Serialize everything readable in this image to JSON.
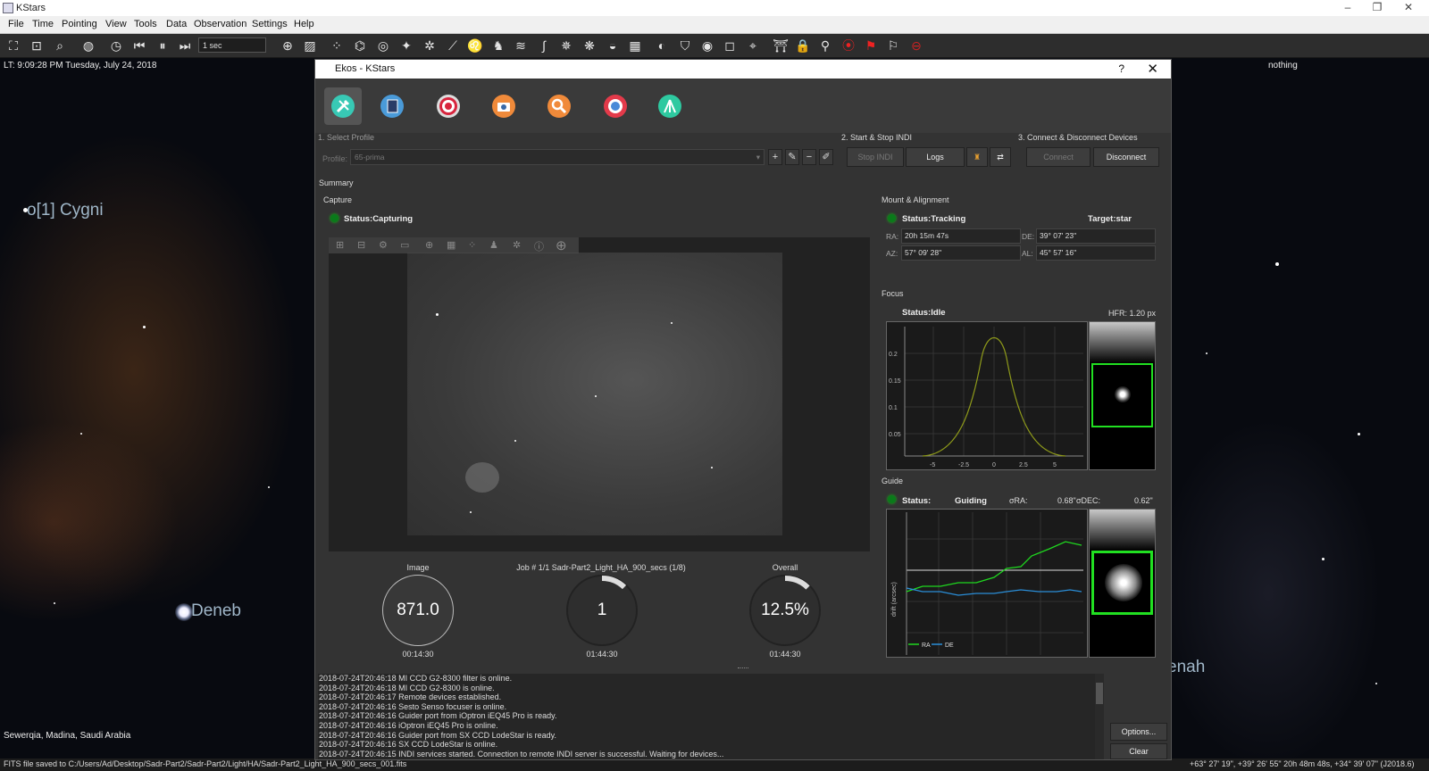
{
  "window": {
    "title": "KStars",
    "controls": [
      "–",
      "❐",
      "✕"
    ]
  },
  "menu": [
    "File",
    "Time",
    "Pointing",
    "View",
    "Tools",
    "Data",
    "Observation",
    "Settings",
    "Help"
  ],
  "toolbar": {
    "time_step": "1 sec"
  },
  "sky": {
    "clock": "LT: 9:09:28 PM   Tuesday, July 24, 2018",
    "focus_object": "nothing",
    "labels": {
      "cygni": "o[1] Cygni",
      "deneb": "Deneb",
      "gienah": "Gienah"
    },
    "location": "Sewerqia, Madina, Saudi Arabia",
    "status_left": "FITS file saved to C:/Users/Ad/Desktop/Sadr-Part2/Sadr-Part2/Light/HA/Sadr-Part2_Light_HA_900_secs_001.fits",
    "status_right": "+63° 27' 19\", +39° 26' 55\"  20h 48m 48s, +34° 39' 07\" (J2018.6)"
  },
  "ekos": {
    "title": "Ekos - KStars",
    "help": "?",
    "close": "✕",
    "modules": [
      "setup",
      "scheduler",
      "mount",
      "capture",
      "focus",
      "guide",
      "align"
    ],
    "sections": {
      "select_profile": "1. Select Profile",
      "start_stop": "2. Start & Stop INDI",
      "connect": "3. Connect & Disconnect Devices"
    },
    "profile_label": "Profile:",
    "profile_value": "65-prima",
    "buttons": {
      "stop_indi": "Stop INDI",
      "logs": "Logs",
      "connect": "Connect",
      "disconnect": "Disconnect",
      "options": "Options...",
      "clear": "Clear"
    },
    "summary": "Summary",
    "capture": {
      "title": "Capture",
      "status": "Status:Capturing",
      "image_label": "Image",
      "image_value": "871.0",
      "image_time": "00:14:30",
      "job_label": "Job # 1/1 Sadr-Part2_Light_HA_900_secs (1/8)",
      "job_value": "1",
      "job_time": "01:44:30",
      "overall_label": "Overall",
      "overall_value": "12.5%",
      "overall_progress": 0.125,
      "overall_time": "01:44:30"
    },
    "mount": {
      "title": "Mount & Alignment",
      "status": "Status:Tracking",
      "target": "Target:star",
      "ra_label": "RA:",
      "ra": "20h 15m 47s",
      "de_label": "DE:",
      "de": "39° 07' 23\"",
      "az_label": "AZ:",
      "az": "57° 09' 28\"",
      "al_label": "AL:",
      "al": "45° 57' 16\""
    },
    "focus": {
      "title": "Focus",
      "status": "Status:Idle",
      "hfr": "HFR: 1.20 px",
      "y_ticks": [
        "0.2",
        "0.15",
        "0.1",
        "0.05"
      ],
      "x_ticks": [
        "-5",
        "-2.5",
        "0",
        "2.5",
        "5"
      ]
    },
    "guide": {
      "title": "Guide",
      "status_label": "Status:",
      "status": "Guiding",
      "ra_rms_label": "σRA:",
      "ra_rms": "0.68\"",
      "dec_rms_label": "σDEC:",
      "dec_rms": "0.62\"",
      "y_axis": "drift (arcsec)",
      "legend_ra": "RA",
      "legend_de": "DE"
    },
    "log": [
      "2018-07-24T20:46:18 MI CCD G2-8300 filter is online.",
      "2018-07-24T20:46:18 MI CCD G2-8300 is online.",
      "2018-07-24T20:46:17 Remote devices established.",
      "2018-07-24T20:46:16 Sesto Senso focuser is online.",
      "2018-07-24T20:46:16 Guider port from iOptron iEQ45 Pro is ready.",
      "2018-07-24T20:46:16 iOptron iEQ45 Pro is online.",
      "2018-07-24T20:46:16 Guider port from SX CCD LodeStar is ready.",
      "2018-07-24T20:46:16 SX CCD LodeStar is online.",
      "2018-07-24T20:46:15 INDI services started. Connection to remote INDI server is successful. Waiting for devices..."
    ]
  },
  "colors": {
    "ra": "#1fd81f",
    "de": "#2a8ed8",
    "accent_green": "#21e021",
    "curve": "#9aa61a"
  }
}
